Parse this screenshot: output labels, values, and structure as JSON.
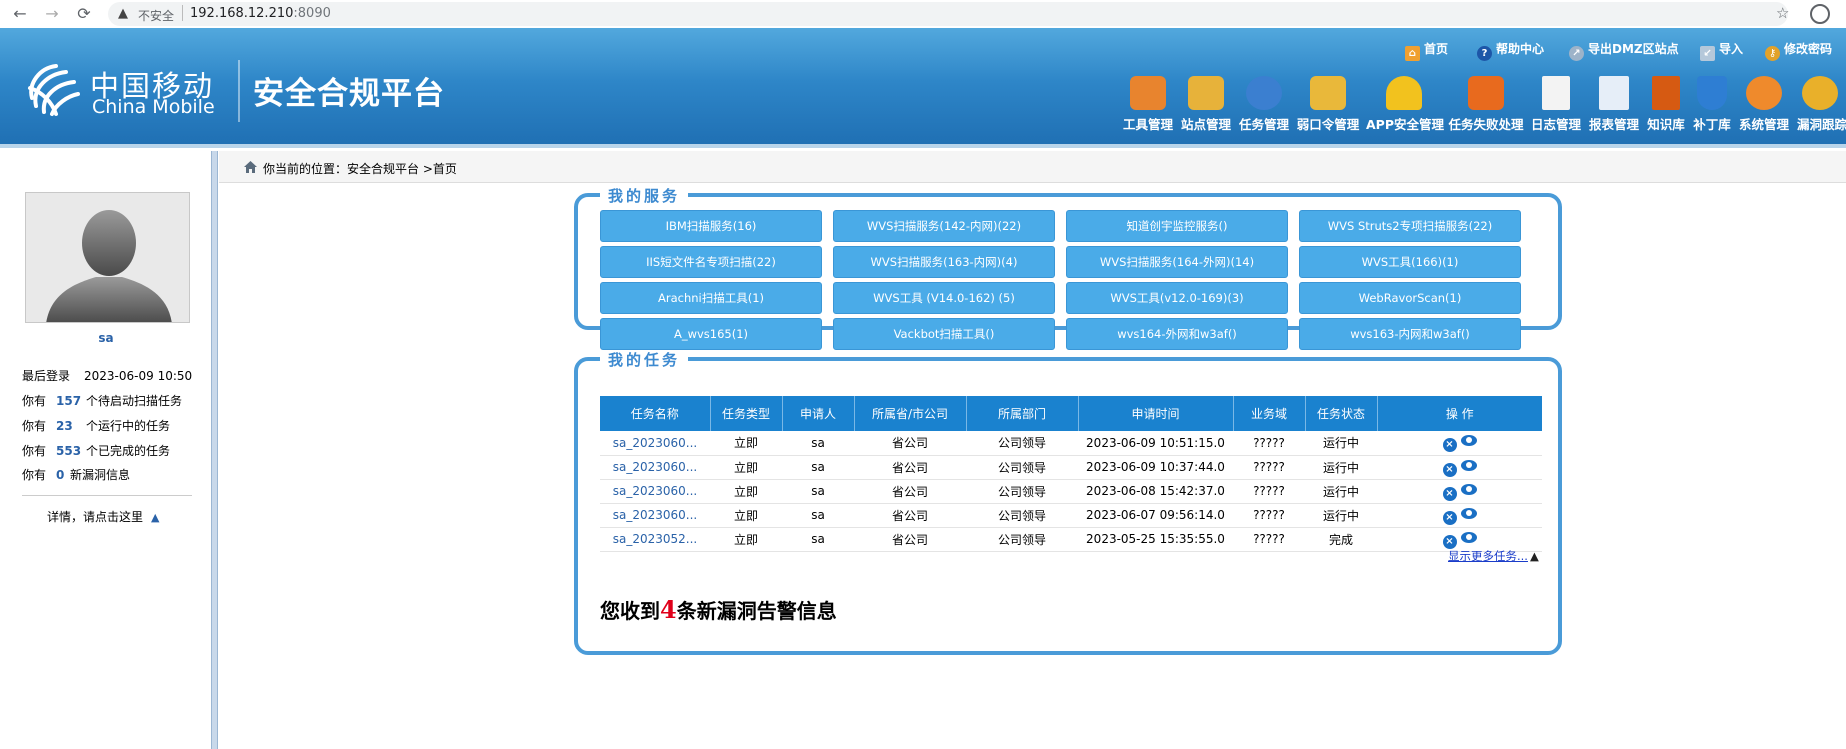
{
  "browser": {
    "insecure_label": "不安全",
    "url_host": "192.168.12.210",
    "url_port": ":8090"
  },
  "header": {
    "logo_cn": "中国移动",
    "logo_en": "China Mobile",
    "platform_title": "安全合规平台",
    "top_links": [
      "首页",
      "帮助中心",
      "导出DMZ区站点",
      "导入",
      "修改密码"
    ],
    "menu": [
      {
        "label": "工具管理",
        "icon": "toolbox-icon",
        "color": "#e8842e"
      },
      {
        "label": "站点管理",
        "icon": "pulse-chart-icon",
        "color": "#e7b23a"
      },
      {
        "label": "任务管理",
        "icon": "pie-chart-icon",
        "color": "#3b7fd0"
      },
      {
        "label": "弱口令管理",
        "icon": "lock-icon",
        "color": "#e9b83a"
      },
      {
        "label": "APP安全管理",
        "icon": "helmet-icon",
        "color": "#f2c21e"
      },
      {
        "label": "任务失败处理",
        "icon": "layers-icon",
        "color": "#e86a1e"
      },
      {
        "label": "日志管理",
        "icon": "document-icon",
        "color": "#f3f3f3"
      },
      {
        "label": "报表管理",
        "icon": "report-search-icon",
        "color": "#e6eef8"
      },
      {
        "label": "知识库",
        "icon": "book-icon",
        "color": "#d65a12"
      },
      {
        "label": "补丁库",
        "icon": "shield-icon",
        "color": "#2e7ed3"
      },
      {
        "label": "系统管理",
        "icon": "gear-badge-icon",
        "color": "#ef8a2c"
      },
      {
        "label": "漏洞跟踪",
        "icon": "bug-icon",
        "color": "#e9b02a"
      }
    ]
  },
  "user": {
    "name": "sa",
    "last_login_label": "最后登录",
    "last_login": "2023-06-09 10:50",
    "stats": [
      {
        "prefix": "你有",
        "count": "157",
        "suffix": "个待启动扫描任务"
      },
      {
        "prefix": "你有",
        "count": "23",
        "suffix": "个运行中的任务"
      },
      {
        "prefix": "你有",
        "count": "553",
        "suffix": "个已完成的任务"
      },
      {
        "prefix": "你有",
        "count": "0",
        "suffix": "新漏洞信息"
      }
    ],
    "detail_link": "详情，请点击这里"
  },
  "breadcrumb": {
    "text": "你当前的位置：安全合规平台 >首页"
  },
  "services": {
    "title": "我的服务",
    "items": [
      "IBM扫描服务(16)",
      "WVS扫描服务(142-内网)(22)",
      "知道创宇监控服务()",
      "WVS Struts2专项扫描服务(22)",
      "IIS短文件名专项扫描(22)",
      "WVS扫描服务(163-内网)(4)",
      "WVS扫描服务(164-外网)(14)",
      "WVS工具(166)(1)",
      "Arachni扫描工具(1)",
      "WVS工具 (V14.0-162) (5)",
      "WVS工具(v12.0-169)(3)",
      "WebRavorScan(1)",
      "A_wvs165(1)",
      "Vackbot扫描工具()",
      "wvs164-外网和w3af()",
      "wvs163-内网和w3af()"
    ]
  },
  "tasks": {
    "title": "我的任务",
    "columns": [
      "任务名称",
      "任务类型",
      "申请人",
      "所属省/市公司",
      "所属部门",
      "申请时间",
      "业务域",
      "任务状态",
      "操 作"
    ],
    "rows": [
      [
        "sa_2023060...",
        "立即",
        "sa",
        "省公司",
        "公司领导",
        "2023-06-09 10:51:15.0",
        "?????",
        "运行中"
      ],
      [
        "sa_2023060...",
        "立即",
        "sa",
        "省公司",
        "公司领导",
        "2023-06-09 10:37:44.0",
        "?????",
        "运行中"
      ],
      [
        "sa_2023060...",
        "立即",
        "sa",
        "省公司",
        "公司领导",
        "2023-06-08 15:42:37.0",
        "?????",
        "运行中"
      ],
      [
        "sa_2023060...",
        "立即",
        "sa",
        "省公司",
        "公司领导",
        "2023-06-07 09:56:14.0",
        "?????",
        "运行中"
      ],
      [
        "sa_2023052...",
        "立即",
        "sa",
        "省公司",
        "公司领导",
        "2023-05-25 15:35:55.0",
        "?????",
        "完成"
      ]
    ],
    "more_link": "显示更多任务...",
    "vuln_prefix": "您收到",
    "vuln_count": "4",
    "vuln_suffix": "条新漏洞告警信息"
  }
}
